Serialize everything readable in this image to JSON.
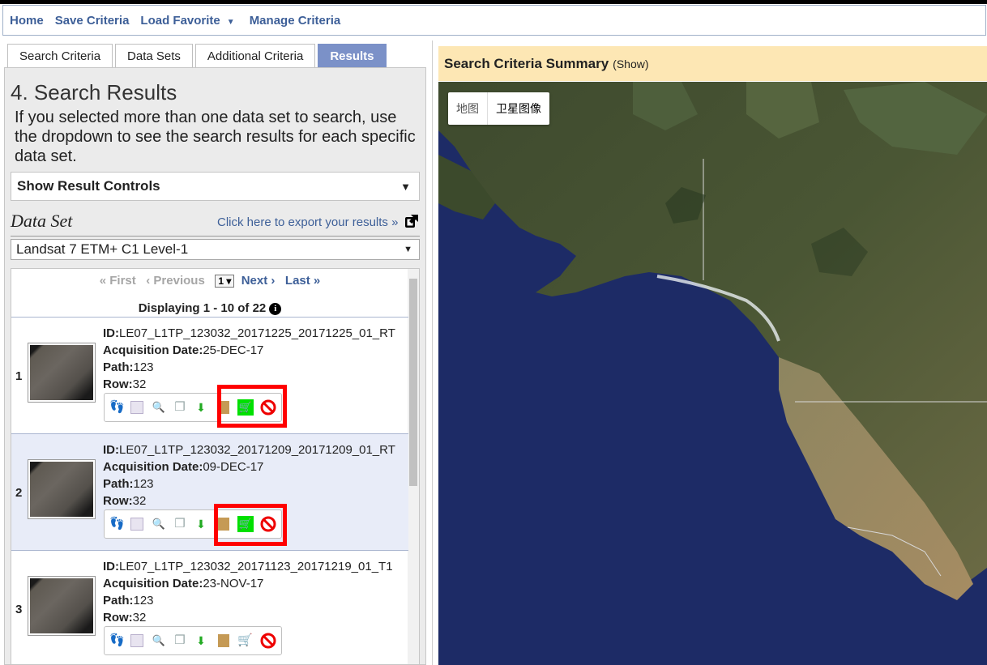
{
  "nav": {
    "home": "Home",
    "save": "Save Criteria",
    "load": "Load Favorite",
    "manage": "Manage Criteria"
  },
  "tabs": [
    "Search Criteria",
    "Data Sets",
    "Additional Criteria",
    "Results"
  ],
  "results": {
    "heading": "4. Search Results",
    "intro": "If you selected more than one data set to search, use the dropdown to see the search results for each specific data set.",
    "controls_label": "Show Result Controls",
    "dataset_label": "Data Set",
    "export_link": "Click here to export your results »",
    "dataset_value": "Landsat 7 ETM+ C1 Level-1",
    "pager": {
      "first": "« First",
      "previous": "‹ Previous",
      "page": "1",
      "next": "Next ›",
      "last": "Last »"
    },
    "displaying": "Displaying 1 - 10 of 22",
    "field_labels": {
      "id": "ID:",
      "date": "Acquisition Date:",
      "path": "Path:",
      "row": "Row:"
    },
    "items": [
      {
        "num": "1",
        "id": "LE07_L1TP_123032_20171225_20171225_01_RT",
        "date": "25-DEC-17",
        "path": "123",
        "row": "32"
      },
      {
        "num": "2",
        "id": "LE07_L1TP_123032_20171209_20171209_01_RT",
        "date": "09-DEC-17",
        "path": "123",
        "row": "32"
      },
      {
        "num": "3",
        "id": "LE07_L1TP_123032_20171123_20171219_01_T1",
        "date": "23-NOV-17",
        "path": "123",
        "row": "32"
      }
    ]
  },
  "map": {
    "summary_title": "Search Criteria Summary",
    "summary_show": "(Show)",
    "maptype_map": "地图",
    "maptype_satellite": "卫星图像"
  },
  "colors": {
    "accent": "#7b91c8",
    "link": "#3d5f98",
    "highlight_box": "#ff0000",
    "cart_active": "#00e000",
    "summary_bg": "#fde7b4"
  }
}
